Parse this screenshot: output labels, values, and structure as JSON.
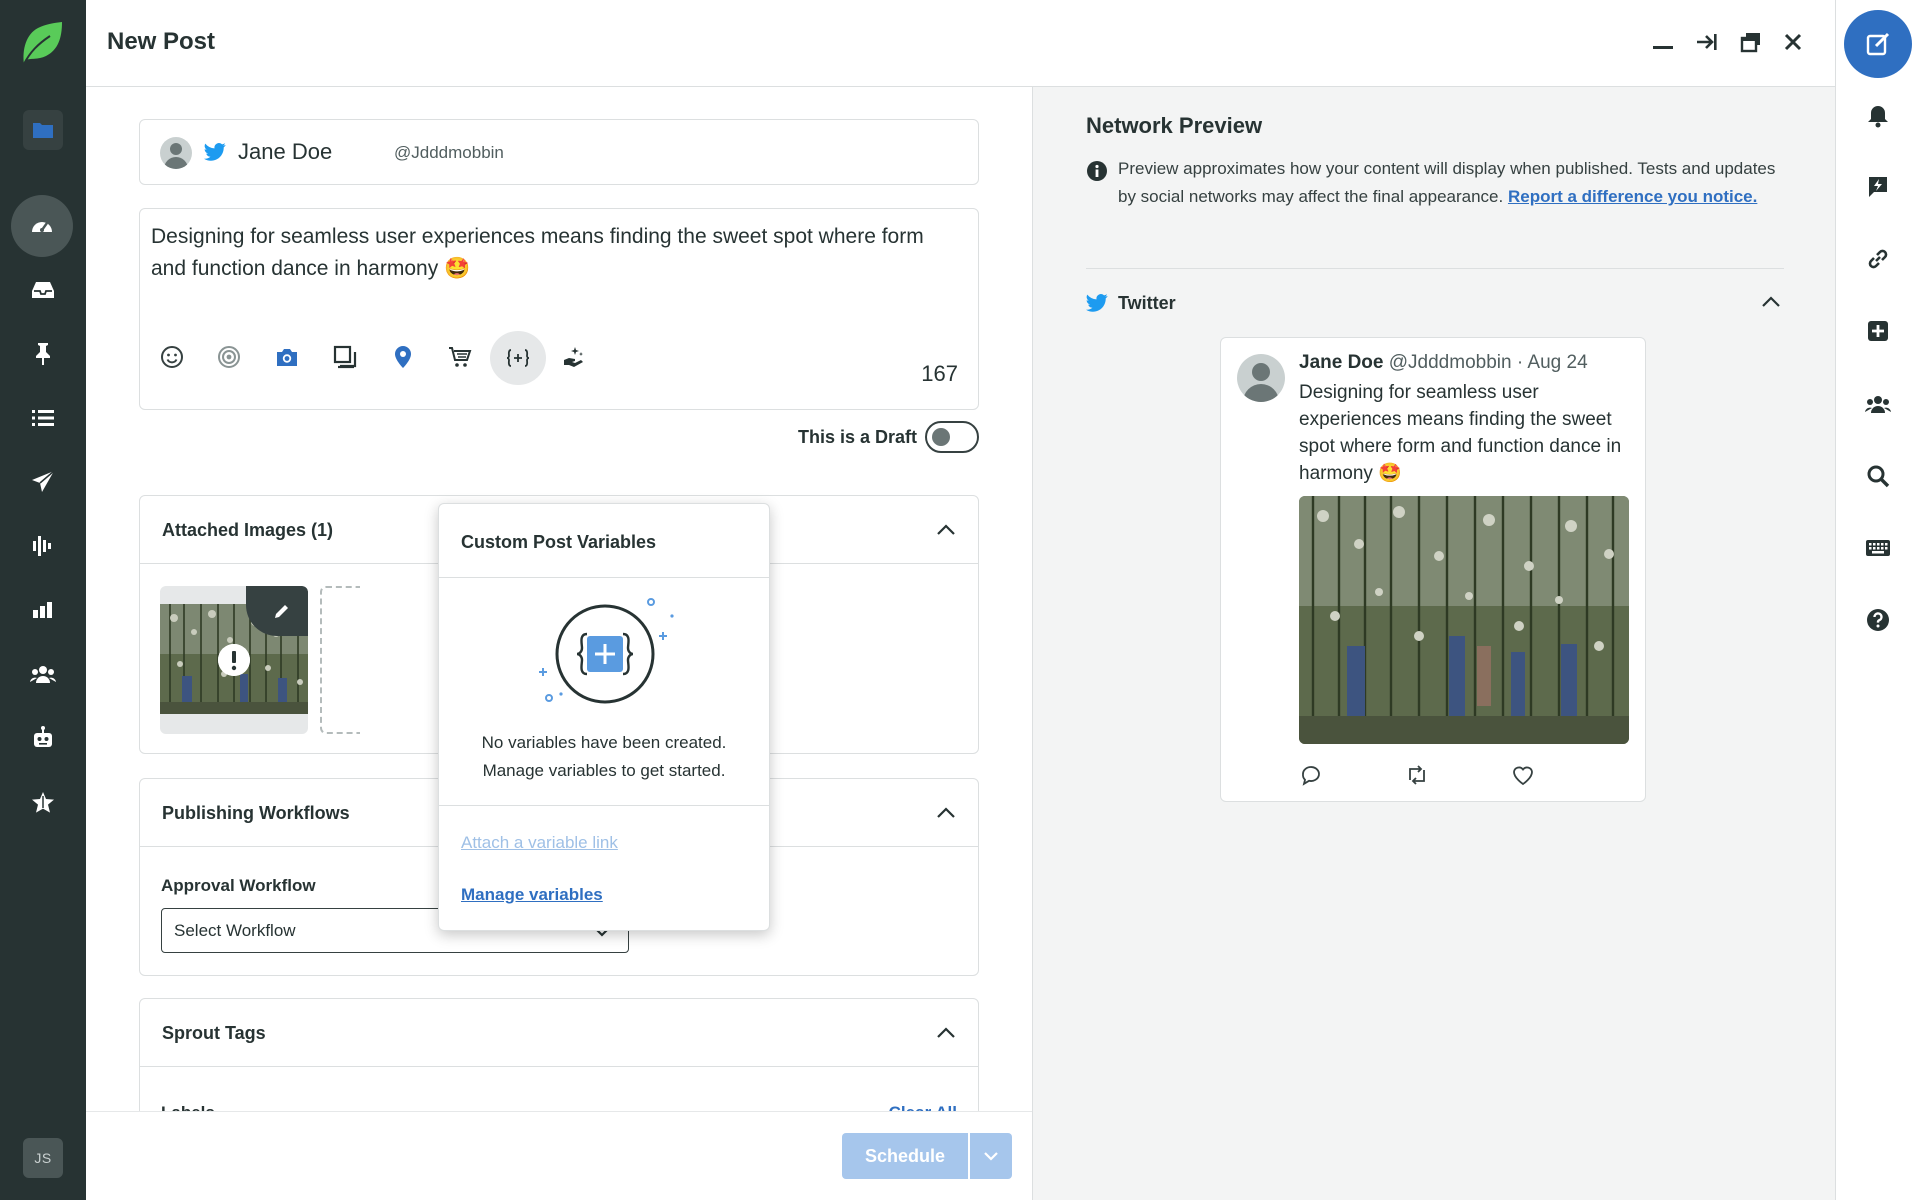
{
  "app": {
    "avatar_initials": "JS"
  },
  "header": {
    "title": "New Post"
  },
  "profile": {
    "name": "Jane Doe",
    "handle": "@Jdddmobbin"
  },
  "composer": {
    "message": "Designing for seamless user experiences means finding the sweet spot where form and function dance in harmony 🤩",
    "char_count": "167",
    "draft_label": "This is a Draft"
  },
  "sections": {
    "attached_images": "Attached Images (1)",
    "publishing_workflows": "Publishing Workflows",
    "approval_workflow_label": "Approval Workflow",
    "workflow_select_value": "Select Workflow",
    "sprout_tags": "Sprout Tags",
    "labels": "Labels",
    "clear_all": "Clear All"
  },
  "popover": {
    "title": "Custom Post Variables",
    "empty_line1": "No variables have been created.",
    "empty_line2": "Manage variables to get started.",
    "attach_link": "Attach a variable link",
    "manage_link": "Manage variables"
  },
  "footer": {
    "schedule_label": "Schedule"
  },
  "preview": {
    "title": "Network Preview",
    "info_text": "Preview approximates how your content will display when published. Tests and updates by social networks may affect the final appearance.",
    "info_link": "Report a difference you notice.",
    "network": "Twitter",
    "tweet": {
      "name": "Jane Doe",
      "handle": "@Jdddmobbin",
      "date": "· Aug 24",
      "text": "Designing for seamless user experiences means finding the sweet spot where form and function dance in harmony 🤩"
    }
  },
  "colors": {
    "accent": "#2f6fc1",
    "nav_bg": "#273333",
    "twitter": "#1d9bf0",
    "brand_green": "#59cb59"
  }
}
